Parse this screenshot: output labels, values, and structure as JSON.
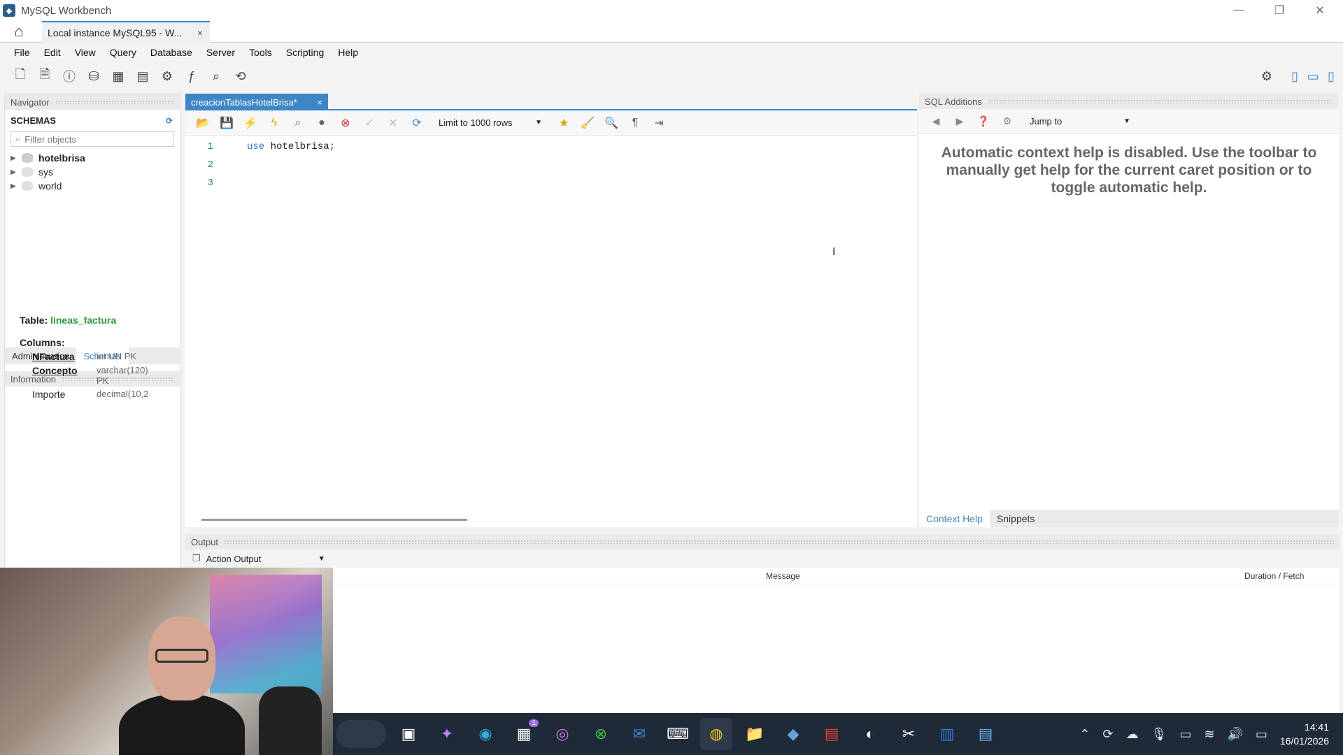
{
  "window": {
    "app_title": "MySQL Workbench",
    "controls": {
      "minimize": "—",
      "restore": "❐",
      "close": "✕"
    }
  },
  "connection_tab": {
    "label": "Local instance MySQL95 - W...",
    "close": "×"
  },
  "menu": [
    "File",
    "Edit",
    "View",
    "Query",
    "Database",
    "Server",
    "Tools",
    "Scripting",
    "Help"
  ],
  "navigator": {
    "title": "Navigator",
    "schemas_label": "SCHEMAS",
    "filter_placeholder": "Filter objects",
    "schemas": [
      {
        "name": "hotelbrisa",
        "bold": true
      },
      {
        "name": "sys",
        "bold": false
      },
      {
        "name": "world",
        "bold": false
      }
    ],
    "tabs": [
      "Administration",
      "Schemas"
    ],
    "active_tab": "Schemas",
    "information_title": "Information",
    "table_label": "Table:",
    "table_name": "lineas_factura",
    "columns_label": "Columns:",
    "columns": [
      {
        "name": "NFactura",
        "type": "int UN PK",
        "pk": true
      },
      {
        "name": "Concepto",
        "type": "varchar(120) PK",
        "pk": true
      },
      {
        "name": "Importe",
        "type": "decimal(10,2",
        "pk": false
      }
    ]
  },
  "editor": {
    "tab_label": "creacionTablasHotelBrisa*",
    "tab_close": "×",
    "limit_select": "Limit to 1000 rows",
    "lines": [
      {
        "num": "1",
        "keyword": "use",
        "rest": " hotelbrisa;"
      },
      {
        "num": "2",
        "keyword": "",
        "rest": ""
      },
      {
        "num": "3",
        "keyword": "",
        "rest": ""
      }
    ]
  },
  "sql_additions": {
    "title": "SQL Additions",
    "jump_to": "Jump to",
    "help_text": "Automatic context help is disabled. Use the toolbar to manually get help for the current caret position or to toggle automatic help.",
    "tabs": [
      "Context Help",
      "Snippets"
    ],
    "active_tab": "Context Help"
  },
  "output": {
    "title": "Output",
    "mode": "Action Output",
    "columns": [
      "Message",
      "Duration / Fetch"
    ]
  },
  "taskbar": {
    "time": "14:41",
    "date": "16/01/2026",
    "badge": "1"
  },
  "colors": {
    "accent": "#3e87c6",
    "table_name": "#2a9a3c",
    "taskbar": "#1f2a38"
  }
}
